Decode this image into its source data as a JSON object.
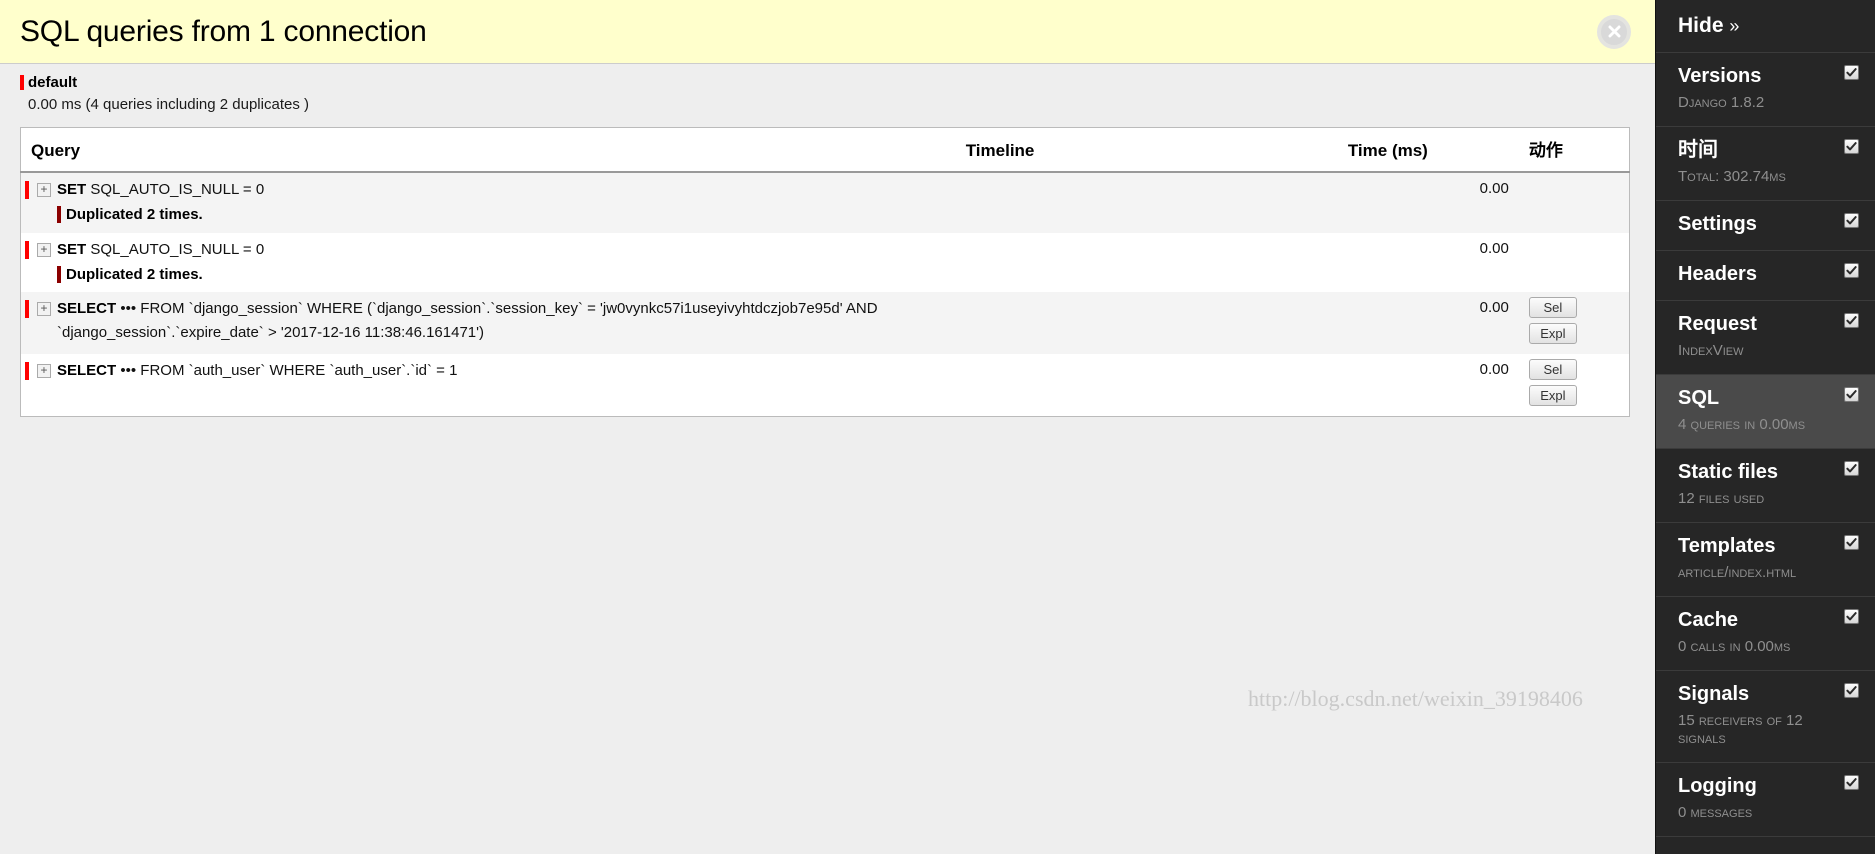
{
  "header": {
    "title": "SQL queries from 1 connection",
    "close_icon": "close-circle-icon"
  },
  "connection": {
    "name": "default",
    "summary": "0.00 ms (4 queries including 2 duplicates )"
  },
  "table": {
    "columns": {
      "query": "Query",
      "timeline": "Timeline",
      "time": "Time (ms)",
      "action": "动作"
    },
    "rows": [
      {
        "toggle": "+",
        "keyword": "SET",
        "sql": " SQL_AUTO_IS_NULL = 0",
        "sql_line2": "",
        "duplicate": "Duplicated 2 times.",
        "time": "0.00",
        "buttons": []
      },
      {
        "toggle": "+",
        "keyword": "SET",
        "sql": " SQL_AUTO_IS_NULL = 0",
        "sql_line2": "",
        "duplicate": "Duplicated 2 times.",
        "time": "0.00",
        "buttons": []
      },
      {
        "toggle": "+",
        "keyword": "SELECT",
        "sql": " ••• FROM `django_session` WHERE (`django_session`.`session_key` = 'jw0vynkc57i1useyivyhtdczjob7e95d' AND",
        "sql_line2": "`django_session`.`expire_date` > '2017-12-16 11:38:46.161471')",
        "duplicate": "",
        "time": "0.00",
        "buttons": [
          "Sel",
          "Expl"
        ]
      },
      {
        "toggle": "+",
        "keyword": "SELECT",
        "sql": " ••• FROM `auth_user` WHERE `auth_user`.`id` = 1",
        "sql_line2": "",
        "duplicate": "",
        "time": "0.00",
        "buttons": [
          "Sel",
          "Expl"
        ]
      }
    ]
  },
  "toolbar": {
    "hide_label": "Hide",
    "hide_chevron": "»",
    "panels": [
      {
        "title": "Versions",
        "subtitle": "Django 1.8.2",
        "checked": true,
        "active": false
      },
      {
        "title": "时间",
        "subtitle": "Total: 302.74ms",
        "checked": true,
        "active": false
      },
      {
        "title": "Settings",
        "subtitle": "",
        "checked": true,
        "active": false
      },
      {
        "title": "Headers",
        "subtitle": "",
        "checked": true,
        "active": false
      },
      {
        "title": "Request",
        "subtitle": "IndexView",
        "checked": true,
        "active": false
      },
      {
        "title": "SQL",
        "subtitle": "4 queries in 0.00ms",
        "checked": true,
        "active": true
      },
      {
        "title": "Static files",
        "subtitle": "12 files used",
        "checked": true,
        "active": false
      },
      {
        "title": "Templates",
        "subtitle": "article/index.html",
        "checked": true,
        "active": false
      },
      {
        "title": "Cache",
        "subtitle": "0 calls in 0.00ms",
        "checked": true,
        "active": false
      },
      {
        "title": "Signals",
        "subtitle": "15 receivers of 12 signals",
        "checked": true,
        "active": false
      },
      {
        "title": "Logging",
        "subtitle": "0 messages",
        "checked": true,
        "active": false
      }
    ]
  },
  "watermark": {
    "text": "http://blog.csdn.net/weixin_39198406"
  },
  "colors": {
    "header_bg": "#ffffcc",
    "toolbar_bg": "#262626",
    "active_panel_bg": "#4a4a4a",
    "query_marker": "#ff0000",
    "duplicate_marker": "#8b0000",
    "page_bg": "#eeeeee"
  }
}
